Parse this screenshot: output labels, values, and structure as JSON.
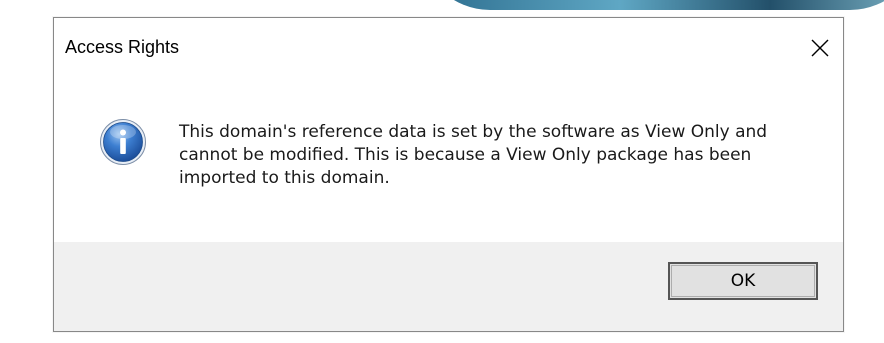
{
  "dialog": {
    "title": "Access Rights",
    "close_icon": "close-icon",
    "info_icon": "information-icon",
    "message": "This domain's reference data is set by the software as View Only and cannot be modified. This is because a View Only package has been imported to this domain.",
    "ok_label": "OK"
  },
  "colors": {
    "footer_background": "#f0f0f0",
    "button_background": "#e1e1e1",
    "button_border": "#555555",
    "info_icon_blue": "#2f6fc3"
  }
}
